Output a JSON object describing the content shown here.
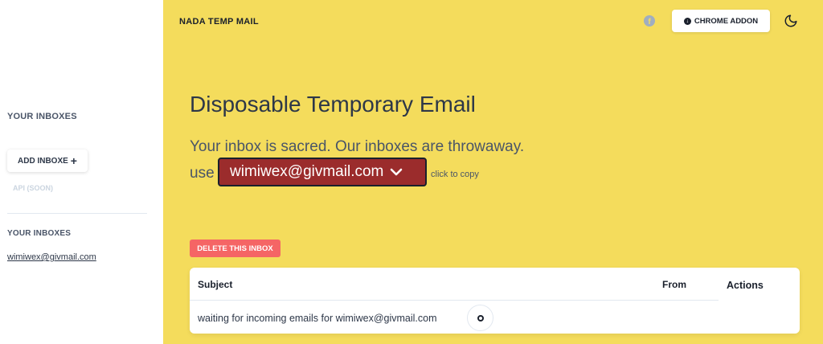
{
  "sidebar": {
    "heading_top": "YOUR INBOXES",
    "add_inbox_label": "ADD INBOXE",
    "add_inbox_icon": "plus-icon",
    "api_label": "API (SOON)",
    "heading_list": "YOUR INBOXES",
    "inboxes": [
      "wimiwex@givmail.com"
    ]
  },
  "header": {
    "brand": "NADA TEMP MAIL",
    "facebook_icon": "facebook-icon",
    "chrome_addon_label": "CHROME ADDON",
    "chrome_addon_icon": "download-icon",
    "theme_toggle_icon": "moon-icon"
  },
  "hero": {
    "title": "Disposable Temporary Email",
    "subtitle": "Your inbox is sacred. Our inboxes are throwaway.",
    "use_label": "use",
    "email": "wimiwex@givmail.com",
    "copy_hint": "click to copy"
  },
  "actions": {
    "delete_inbox_label": "DELETE THIS INBOX"
  },
  "table": {
    "headers": {
      "subject": "Subject",
      "from": "From",
      "actions": "Actions"
    },
    "waiting_text": "waiting for incoming emails for wimiwex@givmail.com"
  },
  "colors": {
    "main_bg": "#f4dc5c",
    "email_pill_bg": "#9b2c2c",
    "delete_btn_bg": "#f56565"
  }
}
